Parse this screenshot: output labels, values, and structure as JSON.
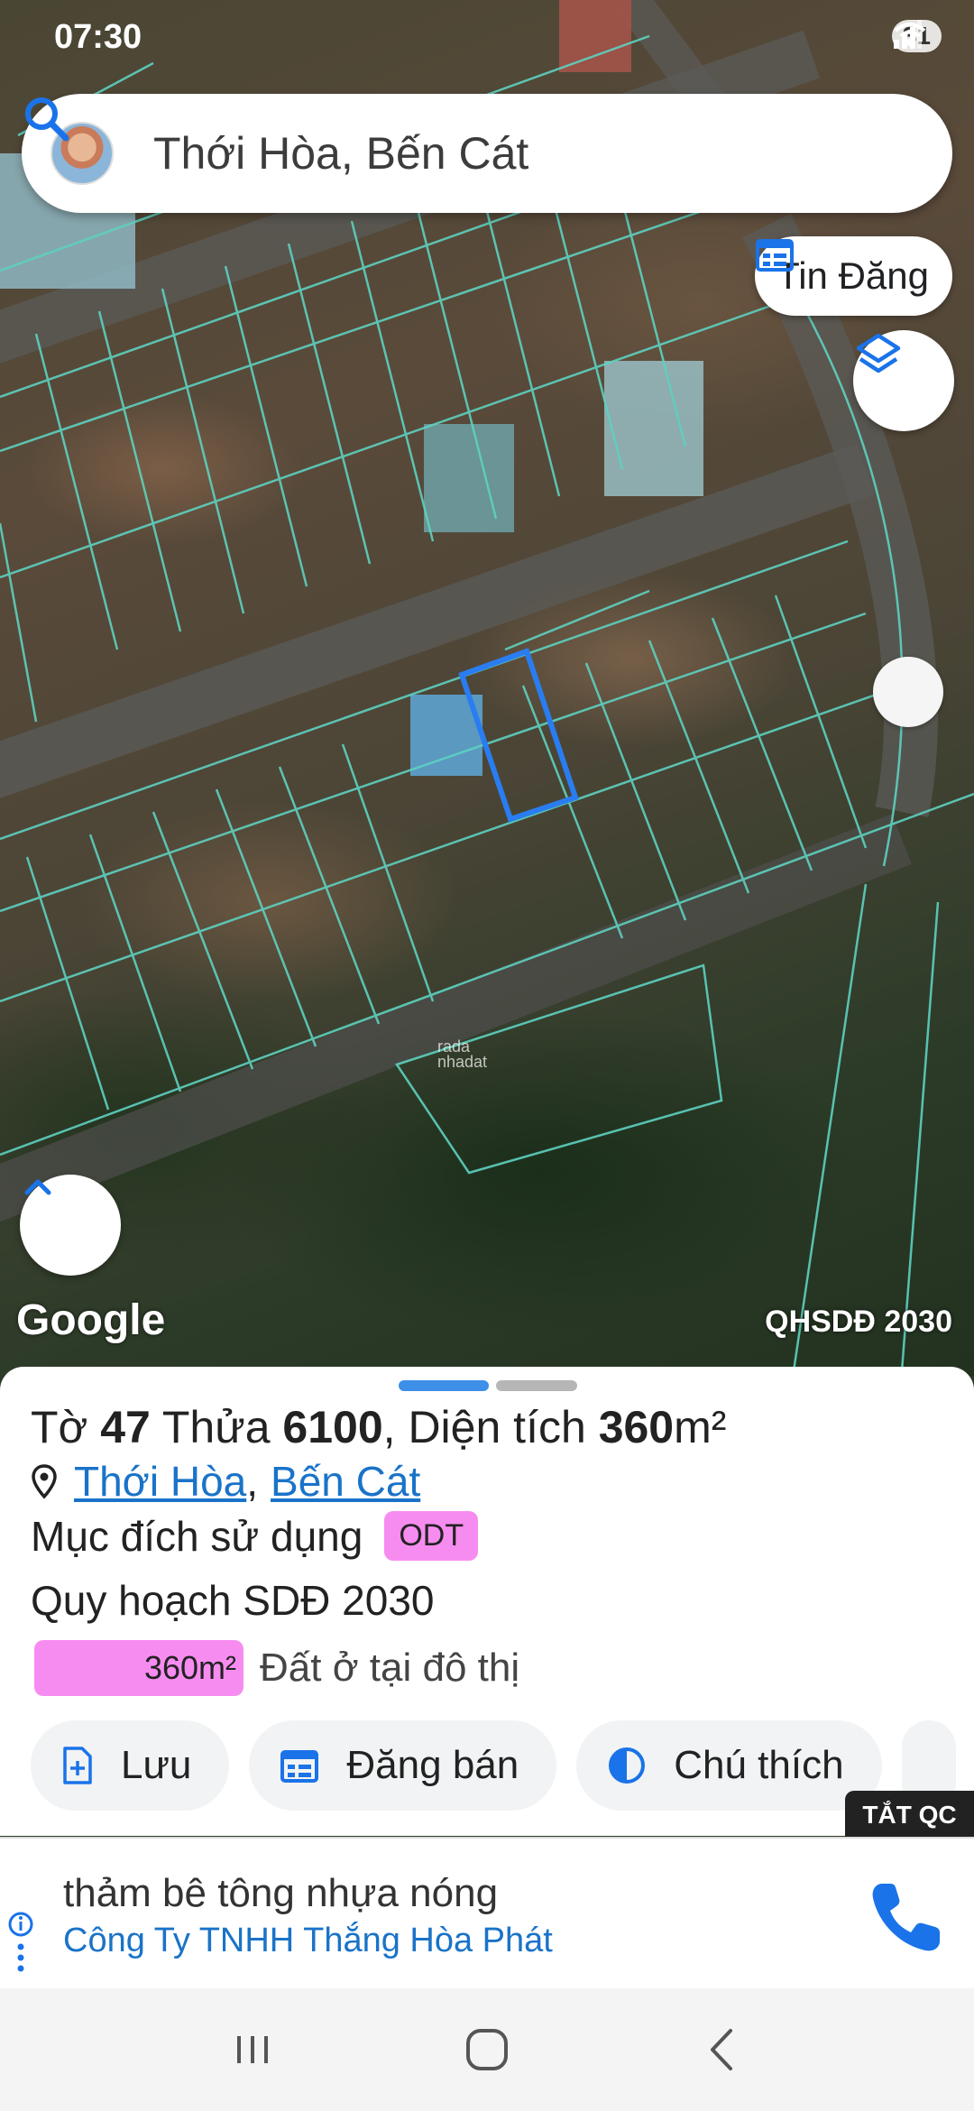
{
  "status_bar": {
    "time": "07:30",
    "battery": "31"
  },
  "search": {
    "query": "Thới Hòa, Bến Cát"
  },
  "map": {
    "tin_dang_label": "Tin Đăng",
    "google_label": "Google",
    "plan_label": "QHSDĐ 2030",
    "watermark_line1": "rada",
    "watermark_line2": "nhadat"
  },
  "parcel": {
    "to_label": "Tờ",
    "to_value": "47",
    "thua_label": "Thửa",
    "thua_value": "6100",
    "area_label": "Diện tích",
    "area_value": "360",
    "area_unit": "m²",
    "ward_link": "Thới Hòa",
    "district_link": "Bến Cát",
    "purpose_label": "Mục đích sử dụng",
    "purpose_code": "ODT",
    "plan_text": "Quy hoạch SDĐ 2030",
    "plan_area": "360m²",
    "plan_land_type": "Đất ở tại đô thị"
  },
  "actions": {
    "save": "Lưu",
    "post_sale": "Đăng bán",
    "legend": "Chú thích"
  },
  "ad": {
    "hide_label": "TẮT QC",
    "title": "thảm bê tông nhựa nóng",
    "advertiser": "Công Ty TNHH Thắng Hòa Phát"
  },
  "colors": {
    "accent": "#1a73c8",
    "odt_pink": "#f78cf0",
    "parcel_lines": "#5ed1c0",
    "selected_parcel": "#2a7df0"
  }
}
